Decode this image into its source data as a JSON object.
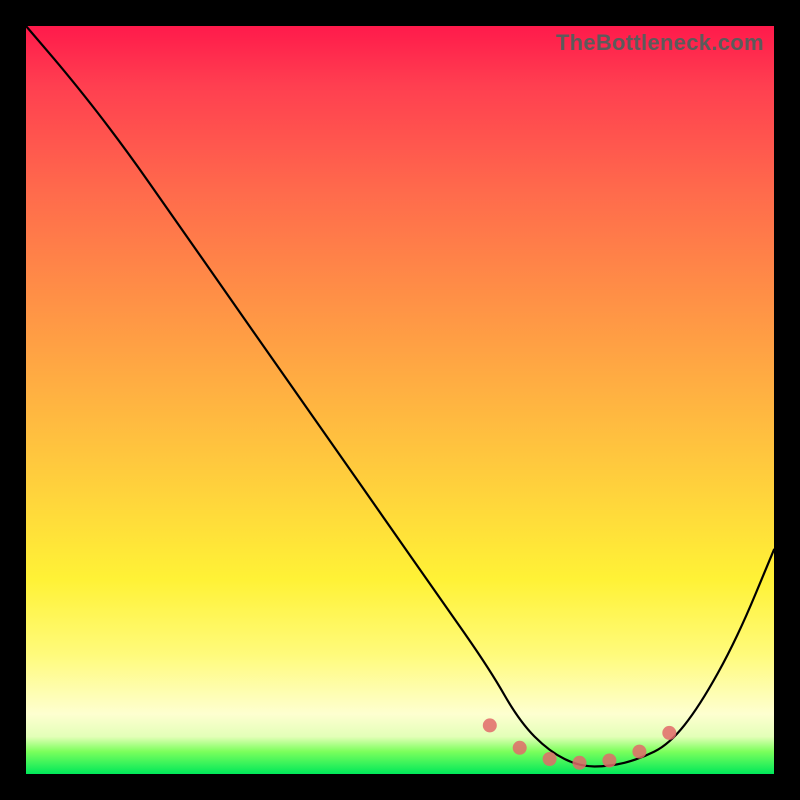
{
  "watermark_text": "TheBottleneck.com",
  "chart_data": {
    "type": "line",
    "title": "",
    "xlabel": "",
    "ylabel": "",
    "xlim": [
      0,
      100
    ],
    "ylim": [
      0,
      100
    ],
    "grid": false,
    "legend": false,
    "series": [
      {
        "name": "bottleneck-curve",
        "x": [
          0,
          6,
          13,
          20,
          27,
          34,
          41,
          48,
          55,
          62,
          66,
          70,
          74,
          78,
          82,
          86,
          90,
          95,
          100
        ],
        "y": [
          100,
          93,
          84,
          74,
          64,
          54,
          44,
          34,
          24,
          14,
          7,
          3,
          1,
          1,
          2,
          4,
          9,
          18,
          30
        ]
      },
      {
        "name": "sweet-spot-markers",
        "x": [
          62,
          66,
          70,
          74,
          78,
          82,
          86
        ],
        "y": [
          6.5,
          3.5,
          2.0,
          1.5,
          1.8,
          3.0,
          5.5
        ]
      }
    ],
    "gradient_stops": [
      {
        "pos": 0,
        "color": "#ff1a4b"
      },
      {
        "pos": 8,
        "color": "#ff3f50"
      },
      {
        "pos": 22,
        "color": "#ff6a4c"
      },
      {
        "pos": 34,
        "color": "#ff8a47"
      },
      {
        "pos": 48,
        "color": "#ffae42"
      },
      {
        "pos": 62,
        "color": "#ffd23c"
      },
      {
        "pos": 74,
        "color": "#fff236"
      },
      {
        "pos": 84,
        "color": "#fffb7b"
      },
      {
        "pos": 92,
        "color": "#feffd0"
      },
      {
        "pos": 95,
        "color": "#e3ffb8"
      },
      {
        "pos": 97,
        "color": "#7bff5c"
      },
      {
        "pos": 100,
        "color": "#00e85a"
      }
    ],
    "marker_color": "#e26a6a",
    "curve_color": "#000000"
  }
}
